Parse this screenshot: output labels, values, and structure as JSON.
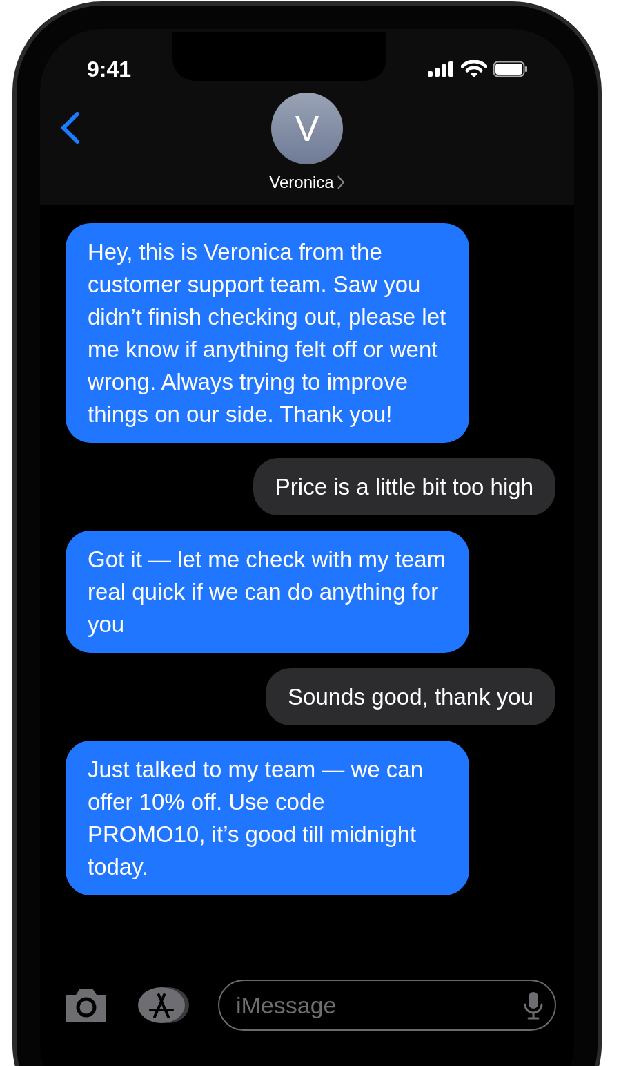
{
  "status_bar": {
    "time": "9:41"
  },
  "header": {
    "avatar_initial": "V",
    "contact_name": "Veronica"
  },
  "messages": [
    {
      "kind": "received",
      "text": "Hey, this is Veronica from the customer support team. Saw you didn’t finish checking out, please let me know if anything felt off or went wrong. Always trying to improve things on our side. Thank you!"
    },
    {
      "kind": "sent",
      "text": "Price is a little bit too high"
    },
    {
      "kind": "received",
      "text": "Got it — let me check with my team real quick if we can do anything for you"
    },
    {
      "kind": "sent",
      "text": "Sounds good, thank you"
    },
    {
      "kind": "received",
      "text": "Just talked to my team — we can offer 10% off. Use code PROMO10, it’s good till midnight today."
    }
  ],
  "composer": {
    "placeholder": "iMessage"
  }
}
